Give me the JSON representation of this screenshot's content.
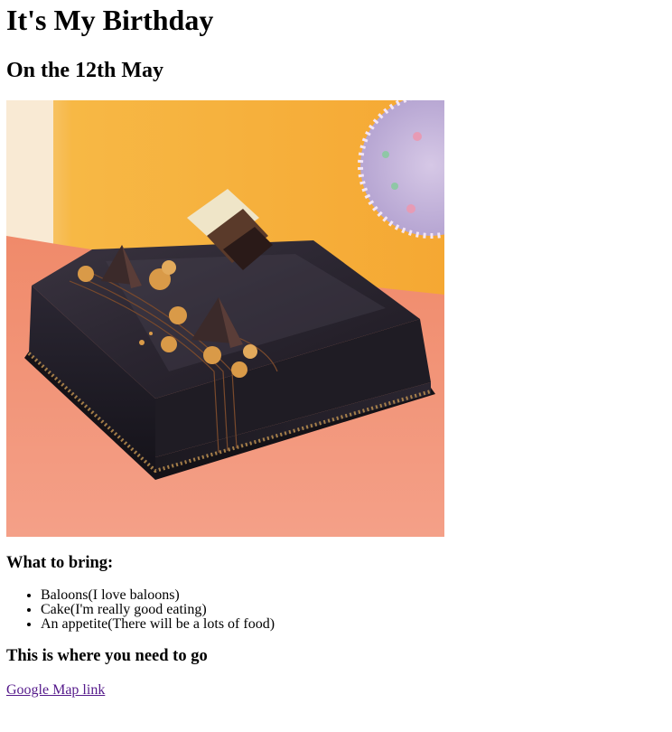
{
  "page": {
    "title": "It's My Birthday",
    "date_heading": "On the 12th May",
    "bring_heading": "What to bring:",
    "bring_items": [
      "Baloons(I love baloons)",
      "Cake(I'm really good eating)",
      "An appetite(There will be a lots of food)"
    ],
    "where_heading": "This is where you need to go",
    "map_link_text": "Google Map link"
  },
  "colors": {
    "link_visited": "#551a8b",
    "text": "#000000",
    "background": "#ffffff"
  }
}
